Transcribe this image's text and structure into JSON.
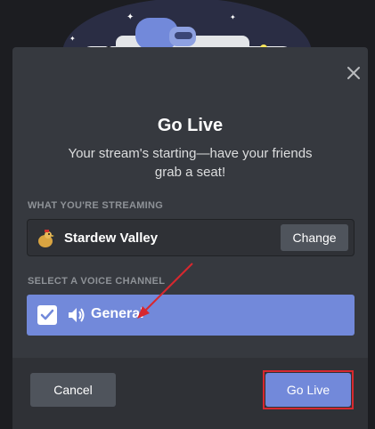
{
  "modal": {
    "title": "Go Live",
    "subtitle": "Your stream's starting—have your friends grab a seat!",
    "streaming_label": "WHAT YOU'RE STREAMING",
    "game_name": "Stardew Valley",
    "change_label": "Change",
    "voice_label": "SELECT A VOICE CHANNEL",
    "channel_name": "General",
    "channel_selected": true,
    "cancel_label": "Cancel",
    "golive_label": "Go Live",
    "icons": {
      "close": "close-icon",
      "game": "stardew-valley-chicken-icon",
      "speaker": "speaker-icon",
      "check": "checkmark-icon"
    }
  },
  "colors": {
    "modal_bg": "#36393f",
    "footer_bg": "#2f3136",
    "accent": "#7289da",
    "secondary_button": "#4f545c",
    "annotation_red": "#d7282f"
  }
}
